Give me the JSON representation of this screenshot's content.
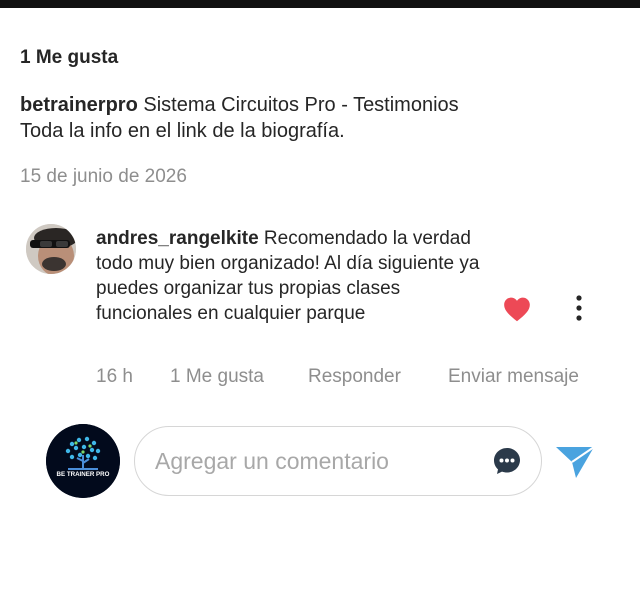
{
  "post": {
    "likes_label": "1 Me gusta",
    "caption_user": "betrainerpro",
    "caption_text_line1": "Sistema Circuitos Pro - Testimonios",
    "caption_text_line2": "Toda la info en el link de la biografía.",
    "date": "15 de junio de 2026"
  },
  "comment": {
    "username": "andres_rangelkite",
    "text": "Recomendado la verdad todo muy bien organizado! Al día siguiente ya puedes organizar tus propias clases funcionales en cualquier parque",
    "time": "16 h",
    "likes_label": "1 Me gusta",
    "reply_label": "Responder",
    "send_message_label": "Enviar mensaje",
    "liked": true,
    "heart_color": "#ed4956"
  },
  "composer": {
    "avatar_brand_text": "BE TRAINER PRO",
    "placeholder": "Agregar un comentario",
    "send_color": "#4aa3df"
  },
  "icons": {
    "like": "heart-icon",
    "more": "more-vertical-icon",
    "emoji": "chat-bubble-icon",
    "send": "send-icon"
  }
}
